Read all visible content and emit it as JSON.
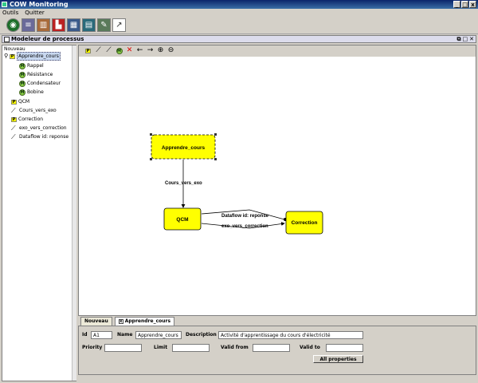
{
  "window": {
    "title": "COW Monitoring",
    "controls": [
      "_",
      "□",
      "x"
    ]
  },
  "menu": [
    "Outils",
    "Quitter"
  ],
  "main_toolbar": [
    "globe-icon",
    "database-icon",
    "books-icon",
    "factory-icon",
    "calendar-icon",
    "grid-icon",
    "tools-icon",
    "chart-icon"
  ],
  "frame": {
    "title": "Modeleur de processus"
  },
  "tree": {
    "root_label": "Nouveau",
    "items": [
      {
        "label": "Apprendre_cours",
        "kind": "P",
        "level": 1,
        "selected": true
      },
      {
        "label": "Rappel",
        "kind": "M",
        "level": 2
      },
      {
        "label": "Résistance",
        "kind": "M",
        "level": 2
      },
      {
        "label": "Condensateur",
        "kind": "M",
        "level": 2
      },
      {
        "label": "Bobine",
        "kind": "M",
        "level": 2
      },
      {
        "label": "QCM",
        "kind": "P",
        "level": 1
      },
      {
        "label": "Cours_vers_exo",
        "kind": "flow",
        "level": 1
      },
      {
        "label": "Correction",
        "kind": "P",
        "level": 1
      },
      {
        "label": "exo_vers_correction",
        "kind": "flow",
        "level": 1
      },
      {
        "label": "Dataflow id: reponse",
        "kind": "dataflow",
        "level": 1
      }
    ]
  },
  "canvas_toolbar": {
    "badge_p": "P",
    "badge_m": "M",
    "delete": "✕",
    "arrow_left": "←",
    "arrow_right": "→",
    "zoom_in": "⊕",
    "zoom_out": "⊖"
  },
  "diagram": {
    "nodes": {
      "apprendre": "Apprendre_cours",
      "qcm": "QCM",
      "correction": "Correction"
    },
    "edges": {
      "cours_vers_exo": "Cours_vers_exo",
      "dataflow": "Dataflow id: reponse",
      "exo_vers_correction": "exo_vers_correction"
    },
    "node_fill": "#ffff00"
  },
  "bottom_tabs": {
    "tab1": "Nouveau",
    "tab2": "Apprendre_cours"
  },
  "properties": {
    "id_label": "Id",
    "id_value": "A1",
    "name_label": "Name",
    "name_value": "Apprendre_cours",
    "description_label": "Description",
    "description_value": "Activité d'apprentissage du cours d'électricité",
    "priority_label": "Priority",
    "priority_value": "",
    "limit_label": "Limit",
    "limit_value": "",
    "valid_from_label": "Valid from",
    "valid_from_value": "",
    "valid_to_label": "Valid to",
    "valid_to_value": "",
    "all_properties_label": "All properties"
  }
}
